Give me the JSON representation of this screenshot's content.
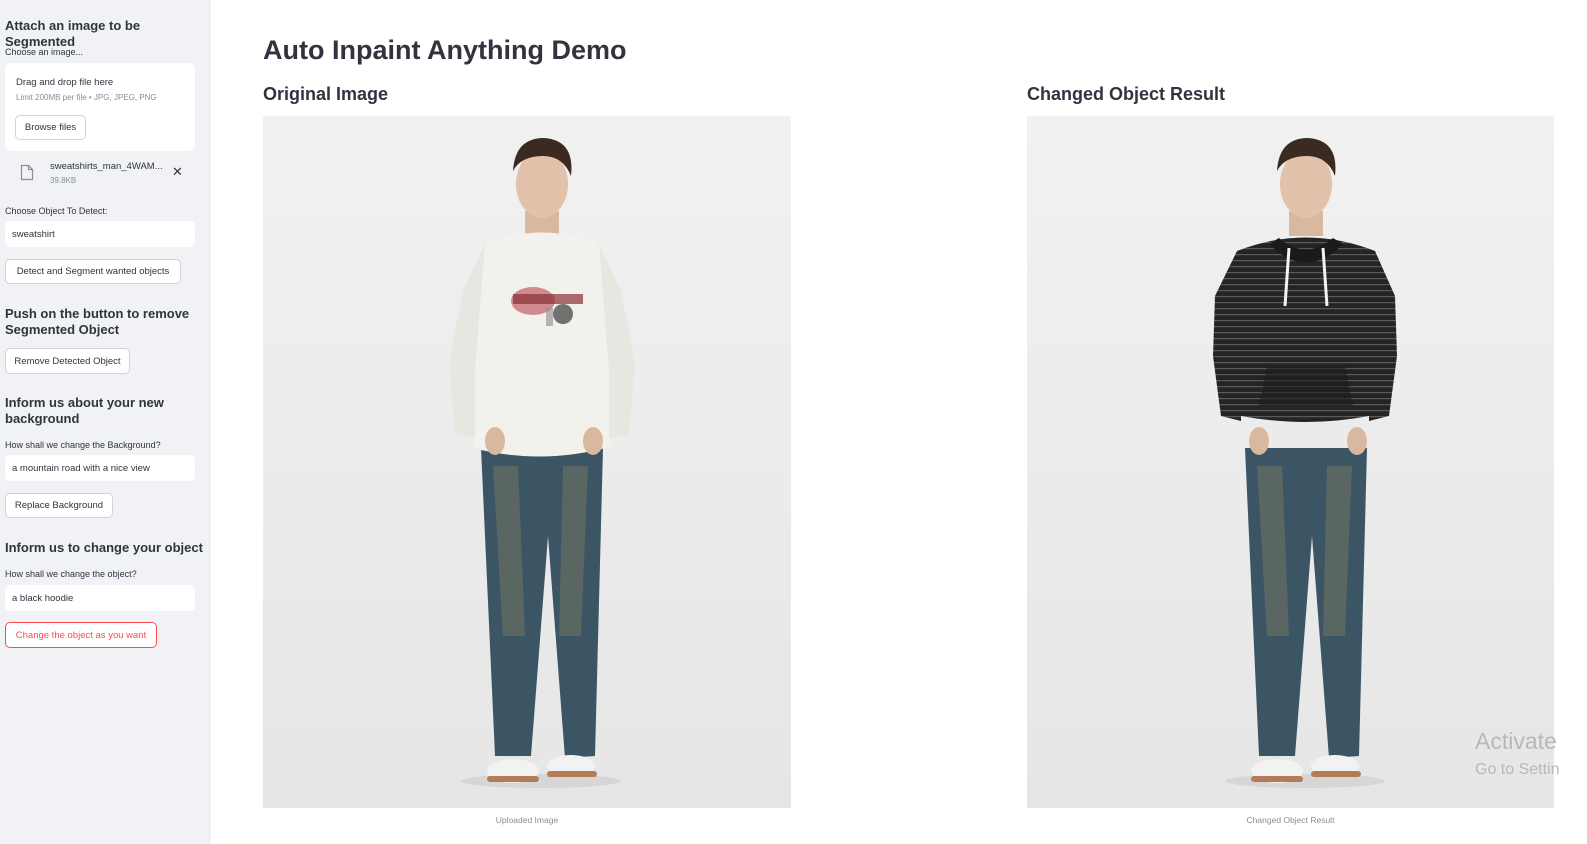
{
  "sidebar": {
    "upload_heading": "Attach an image to be Segmented",
    "upload_label": "Choose an image...",
    "dropzone_title": "Drag and drop file here",
    "dropzone_limits": "Limit 200MB per file • JPG, JPEG, PNG",
    "browse_label": "Browse files",
    "file_name": "sweatshirts_man_4WAM...",
    "file_size": "39.8KB",
    "detect_label": "Choose Object To Detect:",
    "detect_value": "sweatshirt",
    "detect_button": "Detect and Segment wanted objects",
    "remove_heading": "Push on the button to remove Segmented Object",
    "remove_button": "Remove Detected Object",
    "bg_heading": "Inform us about your new background",
    "bg_label": "How shall we change the Background?",
    "bg_value": "a mountain road with a nice view",
    "bg_button": "Replace Background",
    "obj_heading": "Inform us to change your object",
    "obj_label": "How shall we change the object?",
    "obj_value": "a black hoodie",
    "obj_button": "Change the object as you want"
  },
  "main": {
    "title": "Auto Inpaint Anything Demo",
    "original_heading": "Original Image",
    "original_caption": "Uploaded Image",
    "result_heading": "Changed Object Result",
    "result_caption": "Changed Object Result"
  },
  "watermark": {
    "line1": "Activate",
    "line2": "Go to Settin"
  },
  "colors": {
    "sidebar_bg": "#f0f2f6",
    "accent_red": "#ff4b4b",
    "sweatshirt": "#f3f1ec",
    "hoodie": "#242424",
    "jeans": "#3c5565"
  }
}
